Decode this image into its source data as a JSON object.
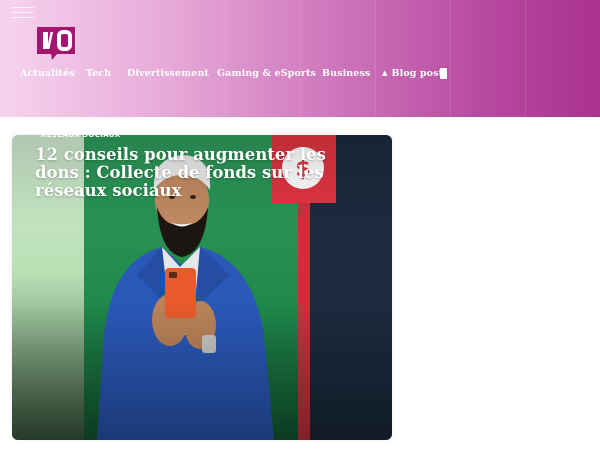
{
  "header": {
    "logo_name": "site-logo",
    "nav": [
      {
        "label": "Actualités"
      },
      {
        "label": "Tech"
      },
      {
        "label": "Divertissement"
      },
      {
        "label": "Gaming & eSports"
      },
      {
        "label": "Business"
      },
      {
        "label": "Blog post"
      }
    ],
    "colors": {
      "gradient_start": "#f7d3ee",
      "gradient_end": "#a9328f",
      "logo": "#a3156f"
    }
  },
  "article": {
    "category": "RÉSEAUX SOCIAUX",
    "title": "12 conseils pour augmenter les dons : Collecte de fonds sur les réseaux sociaux",
    "badge_icon": "dollar-icon"
  }
}
